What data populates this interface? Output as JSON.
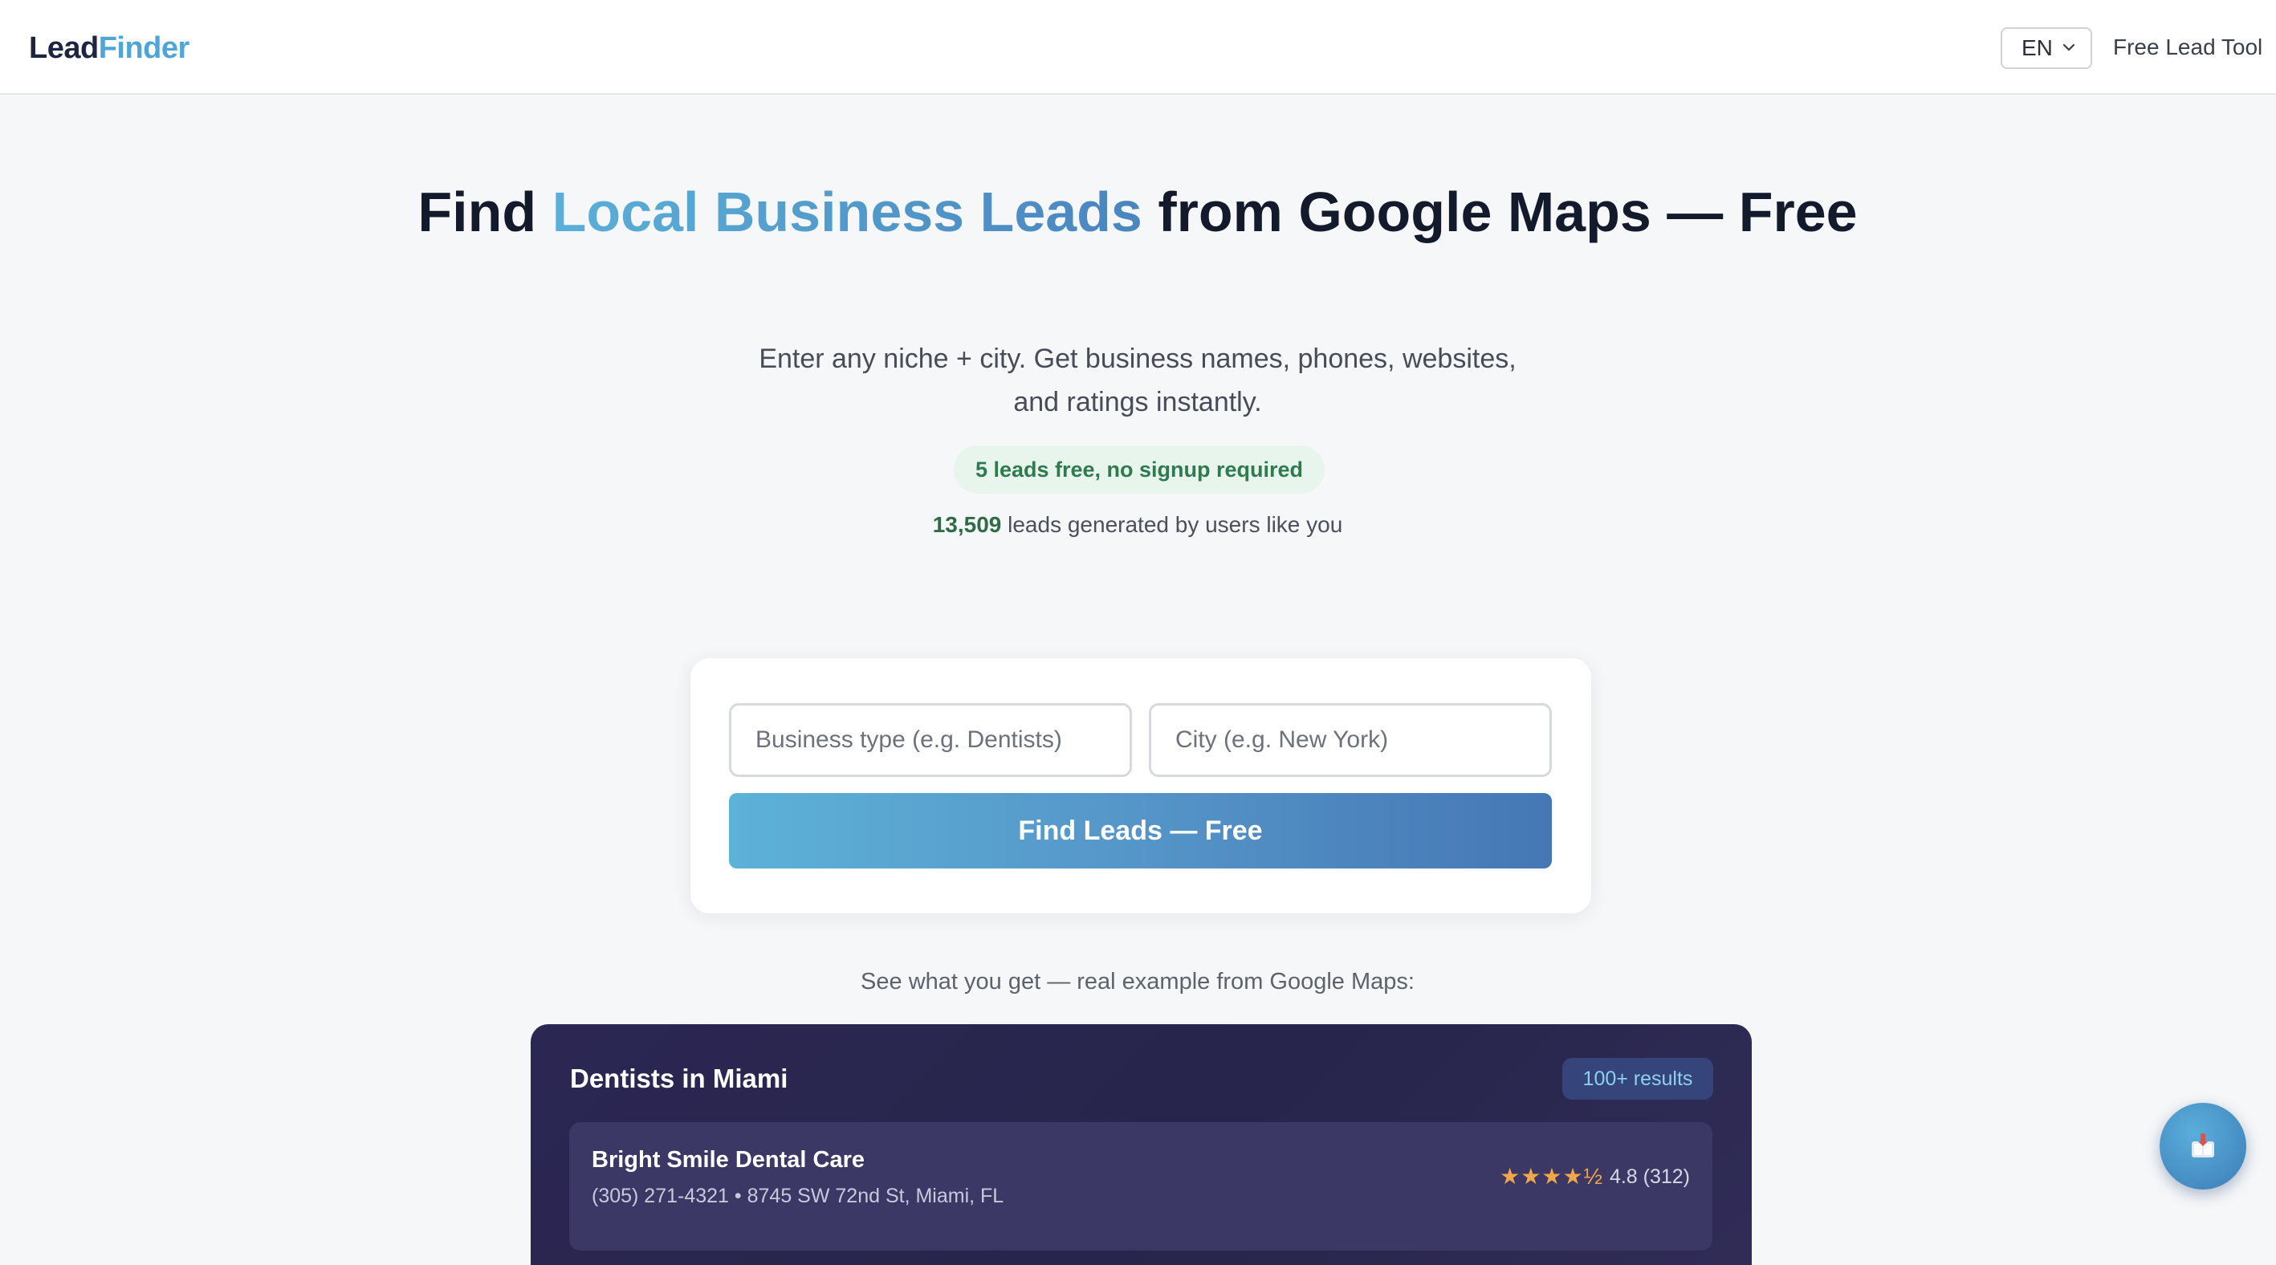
{
  "header": {
    "logo_part1": "Lead",
    "logo_part2": "Finder",
    "language": "EN",
    "right_link": "Free Lead Tool"
  },
  "hero": {
    "title_part1": "Find ",
    "title_accent": "Local Business Leads",
    "title_part2": " from Google Maps — Free",
    "subtitle": "Enter any niche + city. Get business names, phones, websites, and ratings instantly.",
    "free_pill": "5 leads free, no signup required",
    "count_value": "13,509",
    "count_text": " leads generated by users like you"
  },
  "search": {
    "business_placeholder": "Business type (e.g. Dentists)",
    "city_placeholder": "City (e.g. New York)",
    "button_label": "Find Leads — Free"
  },
  "example": {
    "caption": "See what you get — real example from Google Maps:",
    "panel_title": "Dentists in Miami",
    "results_badge": "100+ results",
    "results": [
      {
        "name": "Bright Smile Dental Care",
        "meta": "(305) 271-4321 • 8745 SW 72nd St, Miami, FL",
        "stars": "★★★★½",
        "rating": "4.8 (312)"
      }
    ]
  },
  "colors": {
    "accent": "#4fa5d8",
    "brand_dark": "#1d2540",
    "panel_bg": "#2b2753",
    "success": "#2f7a4f",
    "star": "#f0a64a"
  },
  "icons": {
    "language_dropdown": "chevron-down-icon",
    "floating_button": "chat-book-icon"
  }
}
